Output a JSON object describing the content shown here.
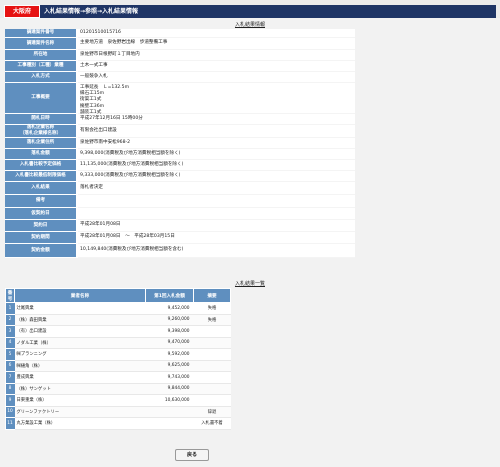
{
  "header": {
    "prefecture": "大阪府",
    "breadcrumb": "入札結果情報→参照→入札結果情報"
  },
  "detail": {
    "title": "入札結果情報",
    "rows": [
      {
        "label": "調達案件番号",
        "value": "01201510015716"
      },
      {
        "label": "調達案件名称",
        "value": "主要地方道　泉佐野岩出線　歩道整備工事"
      },
      {
        "label": "所在地",
        "value": "泉佐野市日根野町１丁目地内"
      },
      {
        "label": "工事種別（工種）業種",
        "value": "土木一式工事"
      },
      {
        "label": "入札方式",
        "value": "一般競争入札"
      },
      {
        "label": "工事概要",
        "value": "工事延長　Ｌ=132.5m\n縁石工15m\n街渠工1式\n擁壁工36m\n舗装工1式"
      },
      {
        "label": "開札日時",
        "value": "平成27年12月16日 15時00分"
      },
      {
        "label": "落札企業名称\n（落札企業様名称）",
        "value": "有限会社出口建設"
      },
      {
        "label": "落札企業住所",
        "value": "泉佐野市南中安松968-2"
      },
      {
        "label": "落札金額",
        "value": "9,398,000(消費税及び地方消費税相当額を除く)"
      },
      {
        "label": "入札書比較予定価格",
        "value": "11,135,000(消費税及び地方消費税相当額を除く)"
      },
      {
        "label": "入札書比較最低制限価格",
        "value": "9,333,000(消費税及び地方消費税相当額を除く)"
      },
      {
        "label": "入札結果",
        "value": "落札者決定"
      },
      {
        "label": "備考",
        "value": ""
      },
      {
        "label": "仮契約日",
        "value": ""
      },
      {
        "label": "契約日",
        "value": "平成28年01月08日"
      },
      {
        "label": "契約期間",
        "value": "平成28年01月08日　～　平成28年03月15日"
      },
      {
        "label": "契約金額",
        "value": "10,149,840(消費税及び地方消費税相当額を含む)"
      }
    ]
  },
  "results": {
    "title": "入札結果一覧",
    "columns": [
      "番号",
      "業者名称",
      "第1回入札金額",
      "摘要"
    ],
    "rows": [
      {
        "no": "1",
        "name": "辻尾興業",
        "amount": "9,452,000",
        "remark": "失格"
      },
      {
        "no": "2",
        "name": "（株）森田興業",
        "amount": "9,260,000",
        "remark": "失格"
      },
      {
        "no": "3",
        "name": "（有）出口建設",
        "amount": "9,398,000",
        "remark": ""
      },
      {
        "no": "4",
        "name": "ノダル工業（株）",
        "amount": "9,470,000",
        "remark": ""
      },
      {
        "no": "5",
        "name": "㈱プランニング",
        "amount": "9,592,000",
        "remark": ""
      },
      {
        "no": "6",
        "name": "㈱樋角（株）",
        "amount": "9,625,000",
        "remark": ""
      },
      {
        "no": "7",
        "name": "豊成興業",
        "amount": "9,743,000",
        "remark": ""
      },
      {
        "no": "8",
        "name": "（株）サンゲット",
        "amount": "9,844,000",
        "remark": ""
      },
      {
        "no": "9",
        "name": "日東重業（株）",
        "amount": "10,630,000",
        "remark": ""
      },
      {
        "no": "10",
        "name": "グリーンファクトリー",
        "amount": "",
        "remark": "辞退"
      },
      {
        "no": "11",
        "name": "丸方業設工業（株）",
        "amount": "",
        "remark": "入札書不着"
      }
    ]
  },
  "footer": {
    "back_label": "戻る"
  }
}
